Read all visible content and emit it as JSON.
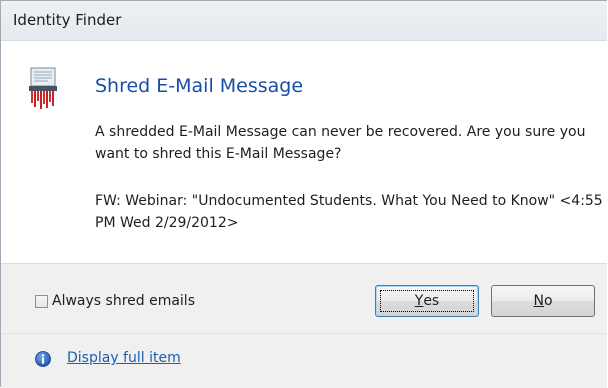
{
  "window": {
    "title": "Identity Finder"
  },
  "main": {
    "heading": "Shred E-Mail Message",
    "message": "A shredded E-Mail Message can never be recovered.  Are you sure you want to shred this E-Mail Message?",
    "item": "FW: Webinar: \"Undocumented Students.  What You Need to Know\" <4:55 PM Wed 2/29/2012>",
    "icon": "shredder-icon"
  },
  "footer": {
    "checkbox_label": "Always shred emails",
    "checkbox_checked": false,
    "yes_button": {
      "label_mnemonic": "Y",
      "label_rest": "es"
    },
    "no_button": {
      "label_mnemonic": "N",
      "label_rest": "o"
    },
    "link_label": "Display full item",
    "link_icon": "info-icon"
  },
  "colors": {
    "heading": "#1a4ea6",
    "link": "#1a5fb4",
    "footer_bg": "#f0f0f0"
  }
}
